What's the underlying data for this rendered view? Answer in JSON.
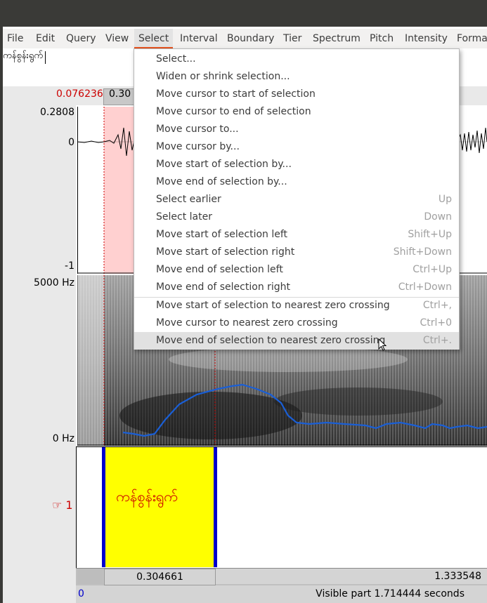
{
  "menubar": {
    "items": [
      {
        "label": "File"
      },
      {
        "label": "Edit"
      },
      {
        "label": "Query"
      },
      {
        "label": "View"
      },
      {
        "label": "Select"
      },
      {
        "label": "Interval"
      },
      {
        "label": "Boundary"
      },
      {
        "label": "Tier"
      },
      {
        "label": "Spectrum"
      },
      {
        "label": "Pitch"
      },
      {
        "label": "Intensity"
      },
      {
        "label": "Forma"
      }
    ],
    "active": "Select"
  },
  "text_field": {
    "value": "ကန်စွန်းရွက်"
  },
  "time_header": {
    "cursor_time": "0.076236",
    "selection_start_partial": "0.30"
  },
  "waveform": {
    "y_max": "0.2808",
    "y_zero": "0",
    "y_min": "-1"
  },
  "spectrogram": {
    "y_max": "5000 Hz",
    "y_min": "0 Hz"
  },
  "tier": {
    "label": "☞ 1",
    "interval_text": "ကန်စွန်းရွက်"
  },
  "bottom": {
    "selection_duration": "0.304661",
    "remaining_duration": "1.333548"
  },
  "status": {
    "left_time": "0",
    "visible": "Visible part 1.714444 seconds"
  },
  "select_menu": {
    "items": [
      {
        "label": "Select...",
        "accel": ""
      },
      {
        "label": "Widen or shrink selection...",
        "accel": ""
      },
      {
        "label": "Move cursor to start of selection",
        "accel": ""
      },
      {
        "label": "Move cursor to end of selection",
        "accel": ""
      },
      {
        "label": "Move cursor to...",
        "accel": ""
      },
      {
        "label": "Move cursor by...",
        "accel": ""
      },
      {
        "label": "Move start of selection by...",
        "accel": ""
      },
      {
        "label": "Move end of selection by...",
        "accel": ""
      },
      {
        "label": "Select earlier",
        "accel": "Up"
      },
      {
        "label": "Select later",
        "accel": "Down"
      },
      {
        "label": "Move start of selection left",
        "accel": "Shift+Up"
      },
      {
        "label": "Move start of selection right",
        "accel": "Shift+Down"
      },
      {
        "label": "Move end of selection left",
        "accel": "Ctrl+Up"
      },
      {
        "label": "Move end of selection right",
        "accel": "Ctrl+Down"
      },
      {
        "label": "Move start of selection to nearest zero crossing",
        "accel": "Ctrl+,"
      },
      {
        "label": "Move cursor to nearest zero crossing",
        "accel": "Ctrl+0"
      },
      {
        "label": "Move end of selection to nearest zero crossing",
        "accel": "Ctrl+."
      }
    ],
    "highlighted_index": 16
  },
  "colors": {
    "accent": "#e95420",
    "selection": "#ffd0d0",
    "interval": "#ffff00",
    "boundary": "#0000cc",
    "pitch": "#1a5fd6"
  }
}
